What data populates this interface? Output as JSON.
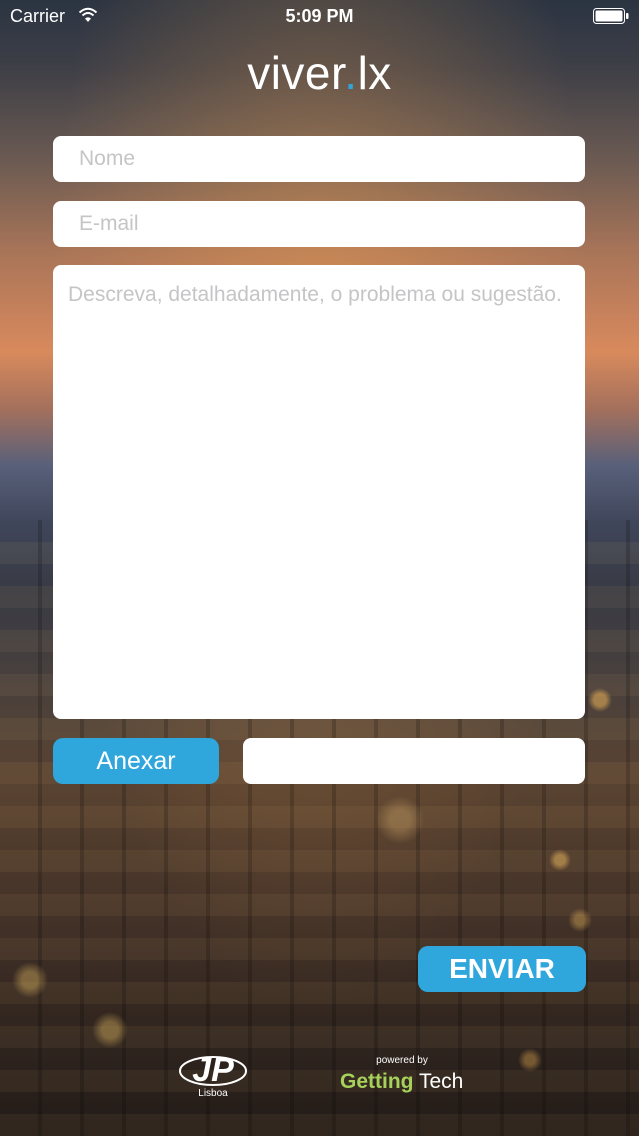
{
  "status_bar": {
    "carrier": "Carrier",
    "time": "5:09 PM"
  },
  "app": {
    "logo_main": "viver",
    "logo_dot": ".",
    "logo_suffix": "lx",
    "accent_color": "#2fa7dc"
  },
  "form": {
    "name_placeholder": "Nome",
    "email_placeholder": "E-mail",
    "message_placeholder": "Descreva, detalhadamente, o problema ou sugestão.",
    "attach_label": "Anexar",
    "attachment_value": "",
    "send_label": "ENVIAR"
  },
  "footer": {
    "jp_logo_text": "JP",
    "jp_city": "Lisboa",
    "powered_by": "powered by",
    "brand_getting": "Getting",
    "brand_tech": "Tech"
  }
}
